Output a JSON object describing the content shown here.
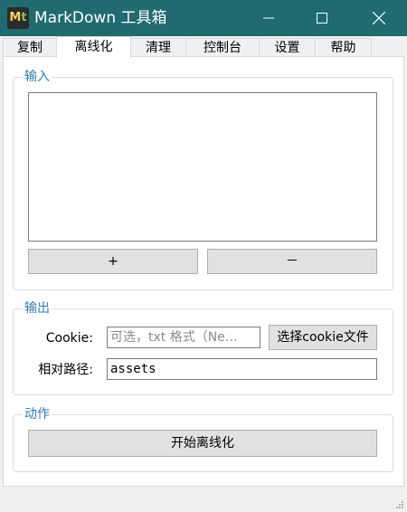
{
  "window": {
    "app_icon": {
      "name": "markdown-tool-app-icon",
      "letters": [
        "M",
        "t"
      ]
    },
    "title": "MarkDown 工具箱",
    "controls": [
      "minimize-icon",
      "maximize-icon",
      "close-icon"
    ]
  },
  "tabs": [
    {
      "label": "复制",
      "active": false
    },
    {
      "label": "离线化",
      "active": true
    },
    {
      "label": "清理",
      "active": false
    },
    {
      "label": "控制台",
      "active": false
    },
    {
      "label": "设置",
      "active": false
    },
    {
      "label": "帮助",
      "active": false
    }
  ],
  "input_group": {
    "title": "输入",
    "textarea_value": "",
    "add_label": "+",
    "remove_label": "－"
  },
  "output_group": {
    "title": "输出",
    "cookie_label": "Cookie:",
    "cookie_placeholder": "可选，txt 格式（Ne…",
    "choose_cookie_label": "选择cookie文件",
    "relative_path_label": "相对路径:",
    "relative_path_value": "assets"
  },
  "action_group": {
    "title": "动作",
    "start_label": "开始离线化"
  },
  "colors": {
    "titlebar": "#1f6b70",
    "group_title": "#2a7fb6"
  }
}
